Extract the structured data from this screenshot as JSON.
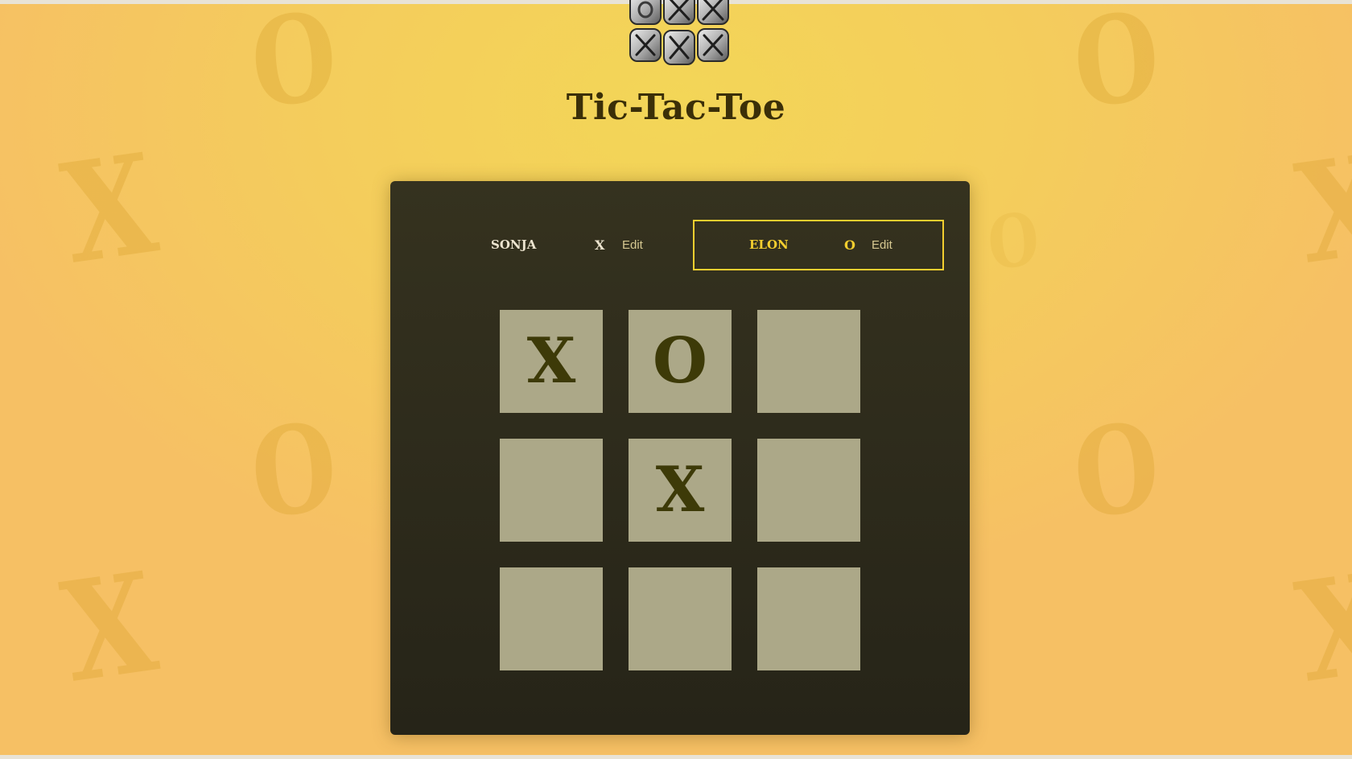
{
  "app": {
    "title": "Tic-Tac-Toe"
  },
  "background": {
    "symbols": [
      "O",
      "X",
      "O",
      "X",
      "O",
      "X",
      "O",
      "X",
      "O"
    ]
  },
  "players": [
    {
      "name": "SONJA",
      "symbol": "X",
      "edit_label": "Edit",
      "active": false
    },
    {
      "name": "ELON",
      "symbol": "O",
      "edit_label": "Edit",
      "active": true
    }
  ],
  "board": {
    "cells": [
      "X",
      "O",
      "",
      "",
      "X",
      "",
      "",
      "",
      ""
    ]
  },
  "colors": {
    "accent": "#f3ce2f",
    "panel": "#2e2c1c",
    "cell": "#aca888",
    "mark": "#3d3a08",
    "title": "#3b2f08"
  }
}
